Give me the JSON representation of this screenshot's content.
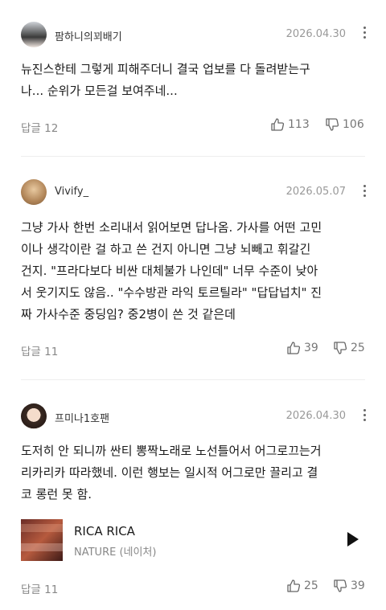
{
  "comments": [
    {
      "nickname": "팜하니의꾀배기",
      "date": "2026.04.30",
      "body_lines": [
        "뉴진스한테 그렇게 피해주더니 결국 업보를 다 돌려받는구",
        "나... 순위가 모든걸 보여주네..."
      ],
      "reply_label": "답글 12",
      "likes": "113",
      "dislikes": "106"
    },
    {
      "nickname": "Vivify_",
      "date": "2026.05.07",
      "body_lines": [
        "그냥 가사 한번 소리내서 읽어보면 답나옴. 가사를 어떤 고민",
        "이나 생각이란 걸 하고 쓴 건지 아니면 그냥 뇌빼고 휘갈긴",
        "건지. \"프라다보다 비싼 대체불가 나인데\" 너무 수준이 낮아",
        "서 웃기지도 않음.. \"수수방관 라익 토르틸라\" \"답답넙치\" 진",
        "짜 가사수준 중딩임? 중2병이 쓴 것 같은데"
      ],
      "reply_label": "답글 11",
      "likes": "39",
      "dislikes": "25"
    },
    {
      "nickname": "프미나1호팬",
      "date": "2026.04.30",
      "body_lines": [
        "도저히 안 되니까 싼티 뽕짝노래로 노선틀어서 어그로끄는거",
        "리카리카 따라했네. 이런 행보는 일시적 어그로만 끌리고 결",
        "코 롱런 못 함."
      ],
      "music": {
        "title": "RICA RICA",
        "artist": "NATURE (네이처)"
      },
      "reply_label": "답글 11",
      "likes": "25",
      "dislikes": "39"
    }
  ]
}
